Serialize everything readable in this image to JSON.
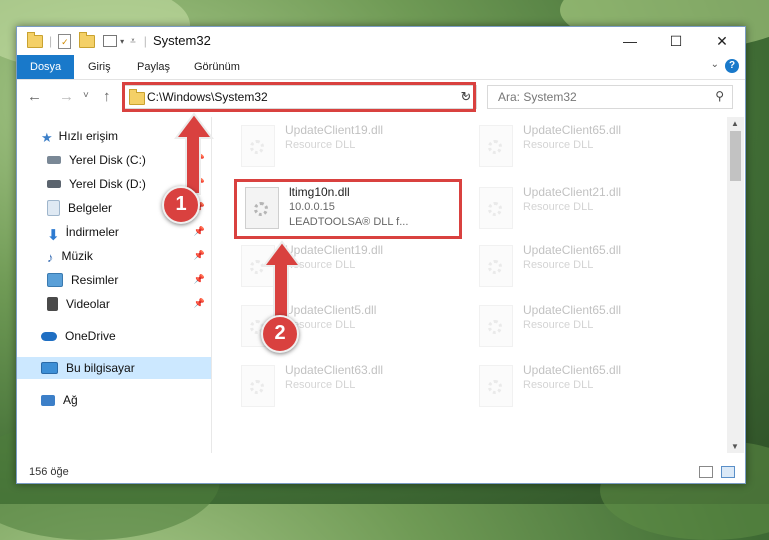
{
  "window": {
    "title": "System32",
    "minimize_glyph": "—",
    "maximize_glyph": "☐",
    "close_glyph": "✕"
  },
  "ribbon": {
    "tabs": [
      "Dosya",
      "Giriş",
      "Paylaş",
      "Görünüm"
    ],
    "help": "?"
  },
  "nav": {
    "back": "←",
    "forward": "→",
    "recent": "˅",
    "up": "↑",
    "address": "C:\\Windows\\System32",
    "refresh": "↻",
    "search_placeholder": "Ara: System32",
    "search_icon": "⚲"
  },
  "sidebar": {
    "items": [
      {
        "label": "Hızlı erişim",
        "icon": "star-icon",
        "color": "#3c7fc8"
      },
      {
        "label": "Yerel Disk (C:)",
        "icon": "drive-icon",
        "color": "#7a8896",
        "pinned": true
      },
      {
        "label": "Yerel Disk (D:)",
        "icon": "drive-icon",
        "color": "#5b646e",
        "pinned": true
      },
      {
        "label": "Belgeler",
        "icon": "documents-icon",
        "color": "#9fb6cc",
        "pinned": true
      },
      {
        "label": "İndirmeler",
        "icon": "download-icon",
        "color": "#2e7bd1",
        "pinned": true
      },
      {
        "label": "Müzik",
        "icon": "music-icon",
        "color": "#3b6fb5",
        "pinned": true
      },
      {
        "label": "Resimler",
        "icon": "pictures-icon",
        "color": "#5aa0d8",
        "pinned": true
      },
      {
        "label": "Videolar",
        "icon": "videos-icon",
        "color": "#4a4a4a",
        "pinned": true
      },
      {
        "label": "OneDrive",
        "icon": "cloud-icon",
        "color": "#1f6fc3"
      },
      {
        "label": "Bu bilgisayar",
        "icon": "computer-icon",
        "color": "#3d8fd6",
        "selected": true
      },
      {
        "label": "Ağ",
        "icon": "network-icon",
        "color": "#3c7fc8"
      }
    ]
  },
  "files": [
    {
      "name": "UpdateClient19.dll",
      "desc": "Resource DLL",
      "faded": true
    },
    {
      "name": "UpdateClient65.dll",
      "desc": "Resource DLL",
      "faded": true
    },
    {
      "name": "ltimg10n.dll",
      "desc": "10.0.0.15",
      "desc2": "LEADTOOLSA® DLL f...",
      "faded": false
    },
    {
      "name": "UpdateClient21.dll",
      "desc": "Resource DLL",
      "faded": true
    },
    {
      "name": "UpdateClient19.dll",
      "desc": "Resource DLL",
      "faded": true
    },
    {
      "name": "UpdateClient65.dll",
      "desc": "Resource DLL",
      "faded": true
    },
    {
      "name": "UpdateClient5.dll",
      "desc": "Resource DLL",
      "faded": true
    },
    {
      "name": "UpdateClient65.dll",
      "desc": "Resource DLL",
      "faded": true
    },
    {
      "name": "UpdateClient63.dll",
      "desc": "Resource DLL",
      "faded": true
    },
    {
      "name": "UpdateClient65.dll",
      "desc": "Resource DLL",
      "faded": true
    }
  ],
  "status": {
    "count": "156 öğe"
  },
  "annotations": {
    "step1": "1",
    "step2": "2",
    "highlight_color": "#d9413f"
  }
}
